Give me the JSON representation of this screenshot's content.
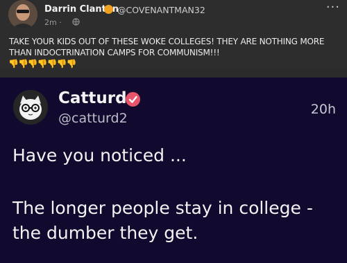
{
  "post": {
    "author_name": "Darrin Clanton",
    "author_handle": "@COVENANTMAN32",
    "time": "2m · ",
    "visibility_icon": "globe-icon",
    "more_label": "···",
    "text": "TAKE YOUR KIDS OUT OF THESE WOKE COLLEGES! THEY ARE NOTHING MORE THAN INDOCTRINATION CAMPS FOR COMMUNISM!!!",
    "emojis": "👎👎👎👎👎👎👎"
  },
  "tweet": {
    "name": "Catturd",
    "handle": "@catturd2",
    "time": "20h",
    "lines": [
      "Have you noticed ...",
      "The longer people stay in college -",
      "the dumber they get."
    ]
  },
  "colors": {
    "post_bg": "#2d2d2d",
    "tweet_bg": "#11092e",
    "verified_orange": "#f0a020",
    "verified_pink": "#e8546a"
  }
}
